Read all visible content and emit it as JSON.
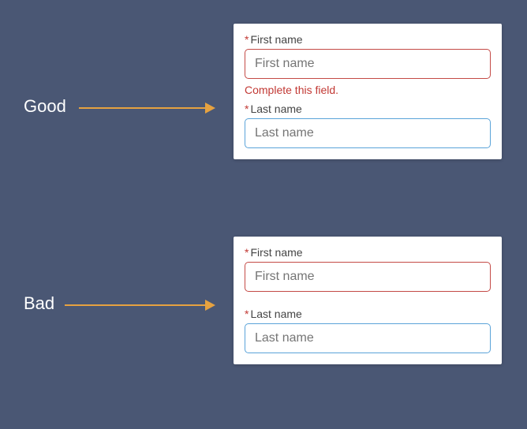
{
  "labels": {
    "good": "Good",
    "bad": "Bad"
  },
  "form": {
    "first_label": "First name",
    "first_placeholder": "First name",
    "last_label": "Last name",
    "last_placeholder": "Last name",
    "required_mark": "*",
    "error_message": "Complete this field."
  }
}
